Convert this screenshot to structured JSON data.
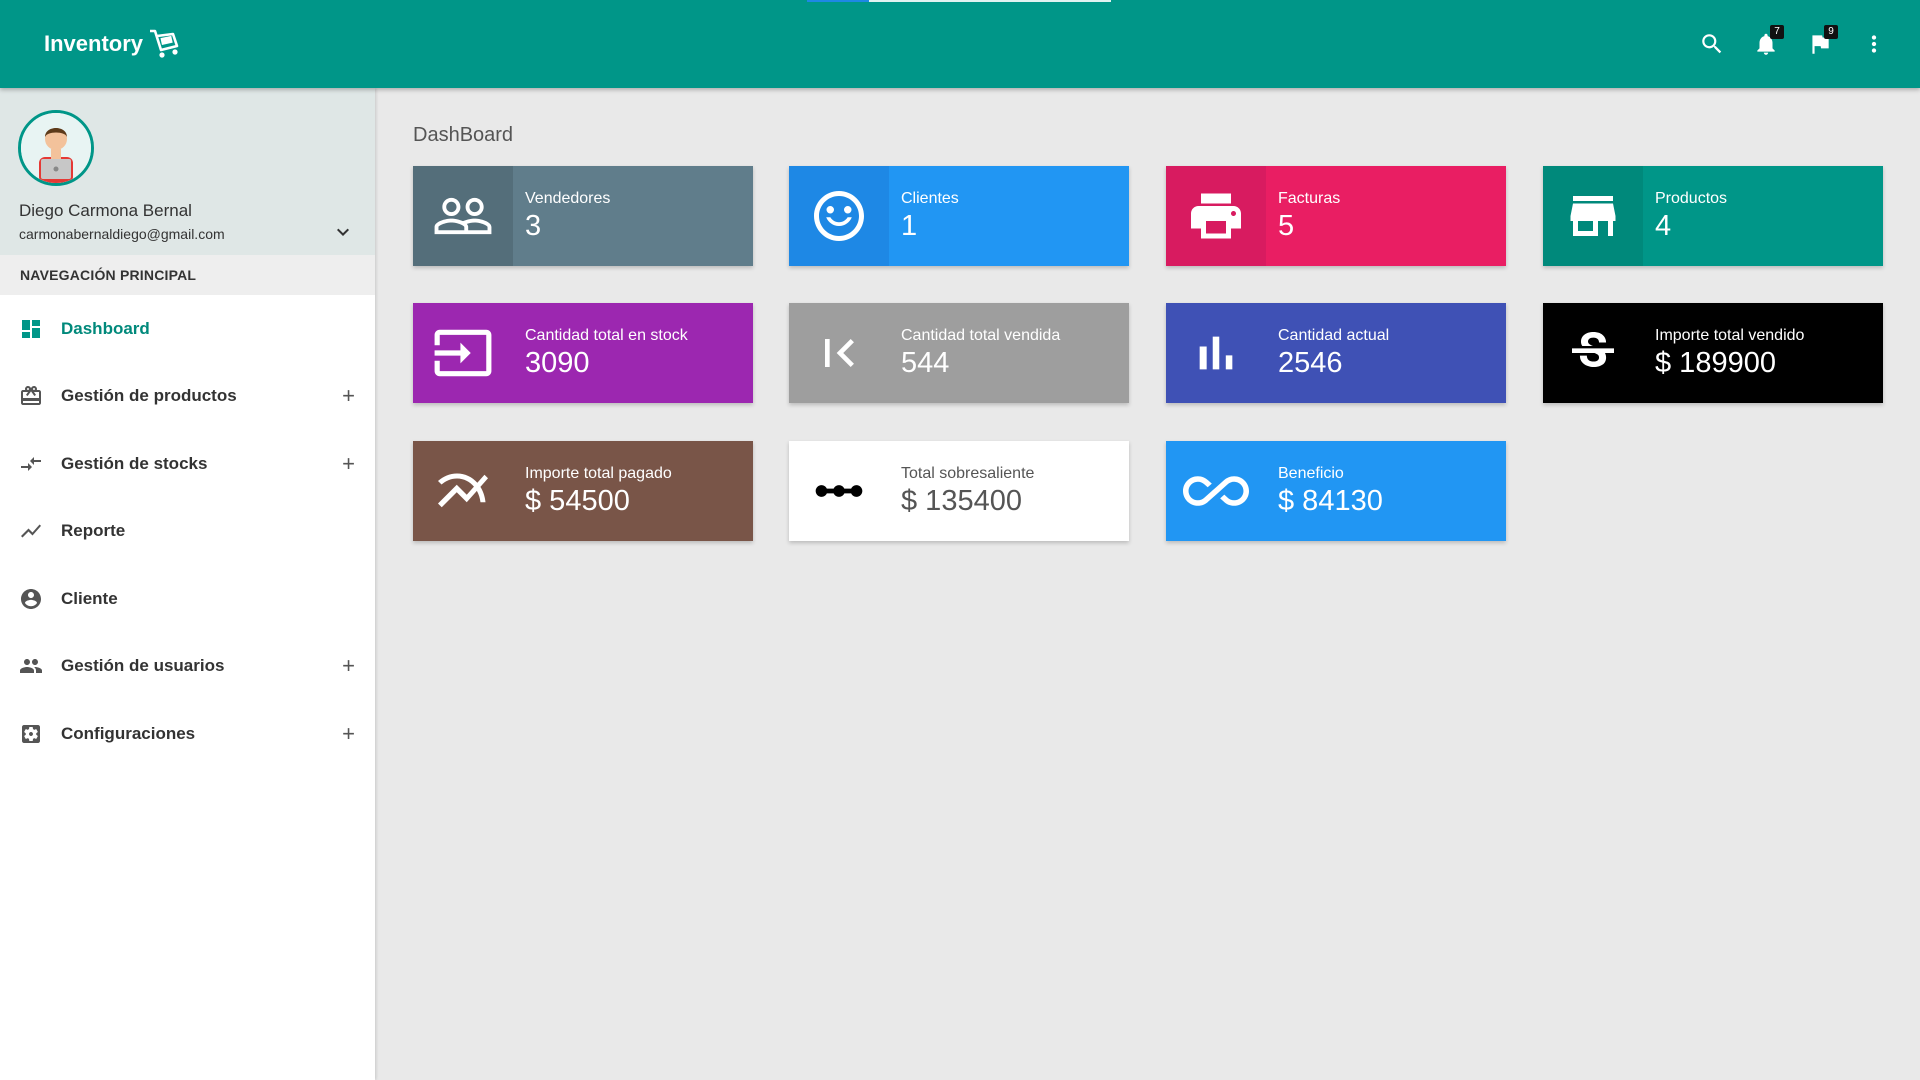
{
  "app": {
    "brand": "Inventory"
  },
  "topbar": {
    "notifications_count": "7",
    "flags_count": "9"
  },
  "user": {
    "name": "Diego Carmona Bernal",
    "email": "carmonabernaldiego@gmail.com"
  },
  "nav": {
    "header": "NAVEGACIÓN PRINCIPAL",
    "items": [
      {
        "label": "Dashboard",
        "icon": "dashboard-icon",
        "active": true
      },
      {
        "label": "Gestión de productos",
        "icon": "card-giftcard-icon",
        "expandable": true
      },
      {
        "label": "Gestión de stocks",
        "icon": "compare-arrows-icon",
        "expandable": true
      },
      {
        "label": "Reporte",
        "icon": "trending-icon"
      },
      {
        "label": "Cliente",
        "icon": "account-circle-icon"
      },
      {
        "label": "Gestión de usuarios",
        "icon": "people-icon",
        "expandable": true
      },
      {
        "label": "Configuraciones",
        "icon": "settings-applications-icon",
        "expandable": true
      }
    ],
    "expand_symbol": "+"
  },
  "page": {
    "title": "DashBoard"
  },
  "cards": [
    {
      "label": "Vendedores",
      "value": "3",
      "icon": "people-outline-icon",
      "color": "#607d8b",
      "icon_bg": "#546e7a"
    },
    {
      "label": "Clientes",
      "value": "1",
      "icon": "smiley-icon",
      "color": "#2196f3",
      "icon_bg": "#1e88e5"
    },
    {
      "label": "Facturas",
      "value": "5",
      "icon": "print-icon",
      "color": "#e91e63",
      "icon_bg": "#d81b60"
    },
    {
      "label": "Productos",
      "value": "4",
      "icon": "store-icon",
      "color": "#009688",
      "icon_bg": "#00897b"
    },
    {
      "label": "Cantidad total en stock",
      "value": "3090",
      "icon": "input-icon",
      "color": "#9c27b0",
      "icon_bg": "#9c27b0"
    },
    {
      "label": "Cantidad total vendida",
      "value": "544",
      "icon": "first-page-icon",
      "color": "#9e9e9e",
      "icon_bg": "#9e9e9e"
    },
    {
      "label": "Cantidad actual",
      "value": "2546",
      "icon": "bar-chart-icon",
      "color": "#3f51b5",
      "icon_bg": "#3f51b5"
    },
    {
      "label": "Importe total vendido",
      "value": "$ 189900",
      "icon": "strikethrough-s-icon",
      "color": "#000000",
      "icon_bg": "#000000"
    },
    {
      "label": "Importe total pagado",
      "value": "$ 54500",
      "icon": "multiline-chart-icon",
      "color": "#795548",
      "icon_bg": "#795548"
    },
    {
      "label": "Total sobresaliente",
      "value": "$ 135400",
      "icon": "linear-scale-icon",
      "color": "#ffffff",
      "icon_bg": "#ffffff"
    },
    {
      "label": "Beneficio",
      "value": "$ 84130",
      "icon": "all-inclusive-icon",
      "color": "#2196f3",
      "icon_bg": "#2196f3"
    }
  ]
}
